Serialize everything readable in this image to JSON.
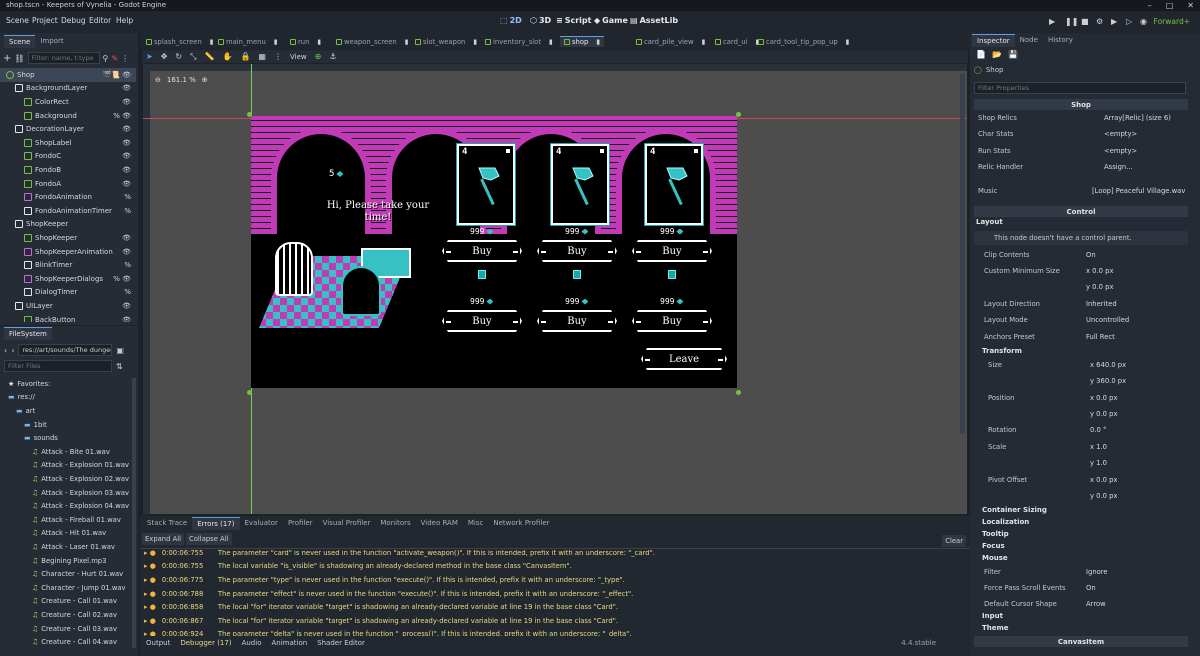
{
  "window": {
    "title": "shop.tscn - Keepers of Vynelia - Godot Engine",
    "controls": [
      "–",
      "□",
      "✕"
    ]
  },
  "menu": [
    "Scene",
    "Project",
    "Debug",
    "Editor",
    "Help"
  ],
  "workspaces": [
    {
      "label": "2D",
      "active": true
    },
    {
      "label": "3D",
      "active": false
    },
    {
      "label": "Script",
      "active": false
    },
    {
      "label": "Game",
      "active": false
    },
    {
      "label": "AssetLib",
      "active": false
    }
  ],
  "renderer": "Forward+",
  "scene_dock": {
    "tabs": [
      "Scene",
      "Import"
    ],
    "filter_placeholder": "Filter: name, t:type",
    "nodes": [
      {
        "label": "Shop",
        "depth": 0,
        "icon": "control",
        "color": "#76c043",
        "flags": "🎬📜  👁",
        "selected": true
      },
      {
        "label": "BackgroundLayer",
        "depth": 1,
        "icon": "canvas",
        "color": "#e6e6e6",
        "flags": "👁"
      },
      {
        "label": "ColorRect",
        "depth": 2,
        "icon": "rect",
        "color": "#76c043",
        "flags": "👁"
      },
      {
        "label": "Background",
        "depth": 2,
        "icon": "rect",
        "color": "#76c043",
        "flags": "% 👁"
      },
      {
        "label": "DecorationLayer",
        "depth": 1,
        "icon": "canvas",
        "color": "#e6e6e6",
        "flags": "👁"
      },
      {
        "label": "ShopLabel",
        "depth": 2,
        "icon": "rect",
        "color": "#76c043",
        "flags": "👁"
      },
      {
        "label": "FondoC",
        "depth": 2,
        "icon": "rect",
        "color": "#76c043",
        "flags": "👁"
      },
      {
        "label": "FondoB",
        "depth": 2,
        "icon": "rect",
        "color": "#76c043",
        "flags": "👁"
      },
      {
        "label": "FondoA",
        "depth": 2,
        "icon": "rect",
        "color": "#76c043",
        "flags": "👁"
      },
      {
        "label": "FondoAnimation",
        "depth": 2,
        "icon": "anim",
        "color": "#c46bd8",
        "flags": "%"
      },
      {
        "label": "FondoAnimationTimer",
        "depth": 2,
        "icon": "timer",
        "color": "#e6e6e6",
        "flags": "%"
      },
      {
        "label": "ShopKeeper",
        "depth": 1,
        "icon": "node",
        "color": "#e6e6e6",
        "flags": ""
      },
      {
        "label": "ShopKeeper",
        "depth": 2,
        "icon": "rect",
        "color": "#76c043",
        "flags": "👁"
      },
      {
        "label": "ShopKeeperAnimation",
        "depth": 2,
        "icon": "anim",
        "color": "#c46bd8",
        "flags": "👁"
      },
      {
        "label": "BlinkTimer",
        "depth": 2,
        "icon": "timer",
        "color": "#e6e6e6",
        "flags": "%"
      },
      {
        "label": "ShopKeeperDialogs",
        "depth": 2,
        "icon": "anim",
        "color": "#c46bd8",
        "flags": "% 👁"
      },
      {
        "label": "DialogTimer",
        "depth": 2,
        "icon": "timer",
        "color": "#e6e6e6",
        "flags": "%"
      },
      {
        "label": "UILayer",
        "depth": 1,
        "icon": "canvas",
        "color": "#e6e6e6",
        "flags": "👁"
      },
      {
        "label": "BackButton",
        "depth": 2,
        "icon": "rect",
        "color": "#76c043",
        "flags": "👁"
      }
    ]
  },
  "filesystem": {
    "title": "FileSystem",
    "path": "res://art/sounds/The dungeo",
    "filter_placeholder": "Filter Files",
    "items": [
      {
        "label": "Favorites:",
        "depth": 0,
        "kind": "star"
      },
      {
        "label": "res://",
        "depth": 0,
        "kind": "folder"
      },
      {
        "label": "art",
        "depth": 1,
        "kind": "folder"
      },
      {
        "label": "1bit",
        "depth": 2,
        "kind": "folder"
      },
      {
        "label": "sounds",
        "depth": 2,
        "kind": "folder"
      },
      {
        "label": "Attack - Bite 01.wav",
        "depth": 3,
        "kind": "audio"
      },
      {
        "label": "Attack - Explosion 01.wav",
        "depth": 3,
        "kind": "audio"
      },
      {
        "label": "Attack - Explosion 02.wav",
        "depth": 3,
        "kind": "audio"
      },
      {
        "label": "Attack - Explosion 03.wav",
        "depth": 3,
        "kind": "audio"
      },
      {
        "label": "Attack - Explosion 04.wav",
        "depth": 3,
        "kind": "audio"
      },
      {
        "label": "Attack - Fireball 01.wav",
        "depth": 3,
        "kind": "audio"
      },
      {
        "label": "Attack - Hit 01.wav",
        "depth": 3,
        "kind": "audio"
      },
      {
        "label": "Attack - Laser 01.wav",
        "depth": 3,
        "kind": "audio"
      },
      {
        "label": "Begining Pixel.mp3",
        "depth": 3,
        "kind": "audio"
      },
      {
        "label": "Character - Hurt 01.wav",
        "depth": 3,
        "kind": "audio"
      },
      {
        "label": "Character - Jump 01.wav",
        "depth": 3,
        "kind": "audio"
      },
      {
        "label": "Creature - Call 01.wav",
        "depth": 3,
        "kind": "audio"
      },
      {
        "label": "Creature - Call 02.wav",
        "depth": 3,
        "kind": "audio"
      },
      {
        "label": "Creature - Call 03.wav",
        "depth": 3,
        "kind": "audio"
      },
      {
        "label": "Creature - Call 04.wav",
        "depth": 3,
        "kind": "audio"
      }
    ]
  },
  "file_tabs": [
    {
      "label": "splash_screen",
      "active": false
    },
    {
      "label": "main_menu",
      "active": false
    },
    {
      "label": "run",
      "active": false
    },
    {
      "label": "weapon_screen",
      "active": false
    },
    {
      "label": "slot_weapon",
      "active": false
    },
    {
      "label": "inventory_slot",
      "active": false
    },
    {
      "label": "shop",
      "active": true
    },
    {
      "label": "card_pile_view",
      "active": false
    },
    {
      "label": "card_ui",
      "active": false
    },
    {
      "label": "card_tool_tip_pop_up",
      "active": false
    }
  ],
  "viewport": {
    "view_label": "View",
    "zoom": "161.1 %"
  },
  "game": {
    "gold": "5",
    "dialog": "Hi, Please take your time!",
    "cards": [
      {
        "cost": "4"
      },
      {
        "cost": "4"
      },
      {
        "cost": "4"
      }
    ],
    "card_prices": [
      "999",
      "999",
      "999"
    ],
    "relic_prices": [
      "999",
      "999",
      "999"
    ],
    "buy_label": "Buy",
    "leave_label": "Leave"
  },
  "bottom": {
    "tabs": [
      "Stack Trace",
      "Errors (17)",
      "Evaluator",
      "Profiler",
      "Visual Profiler",
      "Monitors",
      "Video RAM",
      "Misc",
      "Network Profiler"
    ],
    "expand": "Expand All",
    "collapse": "Collapse All",
    "clear": "Clear",
    "errors": [
      {
        "time": "0:00:06:755",
        "msg": "The parameter \"card\" is never used in the function \"activate_weapon()\". If this is intended, prefix it with an underscore: \"_card\"."
      },
      {
        "time": "0:00:06:755",
        "msg": "The local variable \"is_visible\" is shadowing an already-declared method in the base class \"CanvasItem\"."
      },
      {
        "time": "0:00:06:775",
        "msg": "The parameter \"type\" is never used in the function \"execute()\". If this is intended, prefix it with an underscore: \"_type\"."
      },
      {
        "time": "0:00:06:788",
        "msg": "The parameter \"effect\" is never used in the function \"execute()\". If this is intended, prefix it with an underscore: \"_effect\"."
      },
      {
        "time": "0:00:06:858",
        "msg": "The local \"for\" iterator variable \"target\" is shadowing an already-declared variable at line 19 in the base class \"Card\"."
      },
      {
        "time": "0:00:06:867",
        "msg": "The local \"for\" iterator variable \"target\" is shadowing an already-declared variable at line 19 in the base class \"Card\"."
      },
      {
        "time": "0:00:06:924",
        "msg": "The parameter \"delta\" is never used in the function \"_process()\". If this is intended, prefix it with an underscore: \"_delta\"."
      }
    ],
    "status_tabs": [
      "Output",
      "Debugger (17)",
      "Audio",
      "Animation",
      "Shader Editor"
    ],
    "version": "4.4.stable"
  },
  "inspector": {
    "tabs": [
      "Inspector",
      "Node",
      "History"
    ],
    "node": "Shop",
    "filter_placeholder": "Filter Properties",
    "script_section": "Shop",
    "props": [
      {
        "label": "Shop Relics",
        "value": "Array[Relic] (size 6)"
      },
      {
        "label": "Char Stats",
        "value": "<empty>"
      },
      {
        "label": "Run Stats",
        "value": "<empty>"
      },
      {
        "label": "Relic Handler",
        "value": "Assign..."
      },
      {
        "label": "Music",
        "value": "[Loop] Peaceful Village.wav"
      }
    ],
    "control_section": "Control",
    "layout_header": "Layout",
    "layout_warning": "This node doesn't have a control parent.",
    "layout": [
      {
        "label": "Clip Contents",
        "value": "On"
      },
      {
        "label": "Custom Minimum Size",
        "value": "x 0.0 px"
      },
      {
        "label": "",
        "value": "y 0.0 px"
      },
      {
        "label": "Layout Direction",
        "value": "Inherited"
      },
      {
        "label": "Layout Mode",
        "value": "Uncontrolled"
      },
      {
        "label": "Anchors Preset",
        "value": "Full Rect"
      }
    ],
    "transform_header": "Transform",
    "transform": [
      {
        "label": "Size",
        "value": "x 640.0 px"
      },
      {
        "label": "",
        "value": "y 360.0 px"
      },
      {
        "label": "Position",
        "value": "x 0.0 px"
      },
      {
        "label": "",
        "value": "y 0.0 px"
      },
      {
        "label": "Rotation",
        "value": "0.0 °"
      },
      {
        "label": "Scale",
        "value": "x 1.0"
      },
      {
        "label": "",
        "value": "y 1.0"
      },
      {
        "label": "Pivot Offset",
        "value": "x 0.0 px"
      },
      {
        "label": "",
        "value": "y 0.0 px"
      }
    ],
    "groups": [
      "Container Sizing",
      "Localization",
      "Tooltip",
      "Focus",
      "Mouse"
    ],
    "mouse": [
      {
        "label": "Filter",
        "value": "Ignore"
      },
      {
        "label": "Force Pass Scroll Events",
        "value": "On"
      },
      {
        "label": "Default Cursor Shape",
        "value": "Arrow"
      }
    ],
    "tail_groups": [
      "Input",
      "Theme"
    ],
    "canvasitem": "CanvasItem"
  },
  "colors": {
    "accent": "#5aa0e6",
    "node_green": "#76c043",
    "magenta": "#c13bb7",
    "cyan": "#36c2c5",
    "warning": "#e9d985"
  }
}
